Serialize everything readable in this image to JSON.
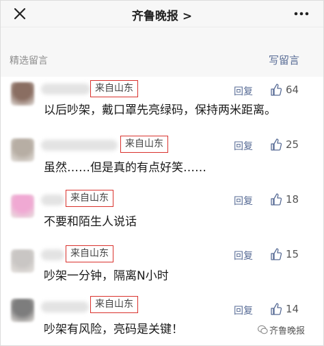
{
  "nav": {
    "title": "齐鲁晚报",
    "chevron": ">"
  },
  "section": {
    "label": "精选留言",
    "write_label": "写留言"
  },
  "comments": [
    {
      "origin": "来自山东",
      "text": "以后吵架，戴口罩先亮绿码，保持两米距离。",
      "reply": "回复",
      "likes": "64",
      "avatar_color": "#8a6e62"
    },
    {
      "origin": "来自山东",
      "text": "虽然……但是真的有点好笑……",
      "reply": "回复",
      "likes": "25",
      "avatar_color": "#b7aea4"
    },
    {
      "origin": "来自山东",
      "text": "不要和陌生人说话",
      "reply": "回复",
      "likes": "18",
      "avatar_color": "#f0a9d3"
    },
    {
      "origin": "来自山东",
      "text": "吵架一分钟，隔离N小时",
      "reply": "回复",
      "likes": "15",
      "avatar_color": "#c9c6c4"
    },
    {
      "origin": "来自山东",
      "text": "吵架有风险，亮码是关键！",
      "reply": "回复",
      "likes": "14",
      "avatar_color": "#7d7d7d"
    }
  ],
  "watermark": "齐鲁晚报",
  "colors": {
    "link": "#576b95",
    "badge_border": "#d9302b",
    "header_bg": "#f7f7f7"
  },
  "icons": {
    "close": "close-icon",
    "more": "more-icon",
    "like": "thumbs-up-icon",
    "watermark": "wechat-official-account-icon"
  }
}
